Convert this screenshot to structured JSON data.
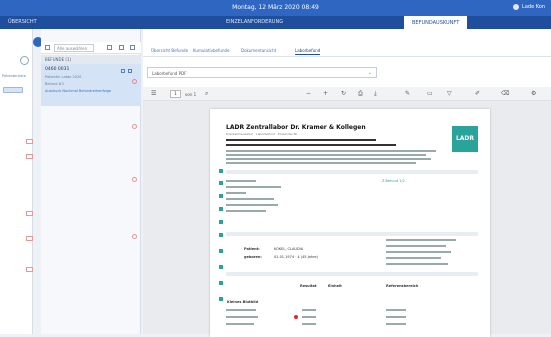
{
  "topbar": {
    "date": "Montag, 12 März 2020 08:49",
    "user": "Lade Kon"
  },
  "tabs": [
    {
      "label": "ÜBERSICHT"
    },
    {
      "label": "EINZELANFORDERUNG"
    },
    {
      "label": "BEFUNDAUSKUNFT"
    }
  ],
  "left": {
    "label": "Patientenliste"
  },
  "list": {
    "filter_placeholder": "Alle auswählen",
    "header": "BEFUNDE (1)",
    "item": {
      "line1": "0460 0031",
      "line2": "Patientin Labor 2020",
      "line3": "Befund #3",
      "line4": "Ausdruck  Nochmal  Befundreihenfolge"
    }
  },
  "subtabs": [
    {
      "label": "Übersicht Befunde"
    },
    {
      "label": "Kumulativbefunde"
    },
    {
      "label": "Dokumentansicht"
    },
    {
      "label": "Laborbefund"
    }
  ],
  "doc_select": "Laborbefund PDF",
  "pdf": {
    "page_current": "1",
    "page_total": "von 1",
    "title": "LADR Zentrallabor Dr. Kramer & Kollegen",
    "subtitle": "Krankenhauslabor · Laborbefund · Einsender-Nr.",
    "logo": "LADR",
    "patient_label": "Patient:",
    "patient_value": "KOKEL, CLAUDIA",
    "dob_label": "geboren:",
    "dob_value": "01.01.1974 · 4 (45 Jahre)",
    "col_result": "Resultat",
    "col_unit": "Einheit",
    "col_ref": "Referenzbereich",
    "section": "Kleines Blutbild",
    "accent_text": "Z-Befund 1/2"
  },
  "colors": {
    "topbar": "#2f66c2",
    "tabbar": "#1f4e9c",
    "accent": "#2aa39a",
    "flag": "#e23"
  }
}
